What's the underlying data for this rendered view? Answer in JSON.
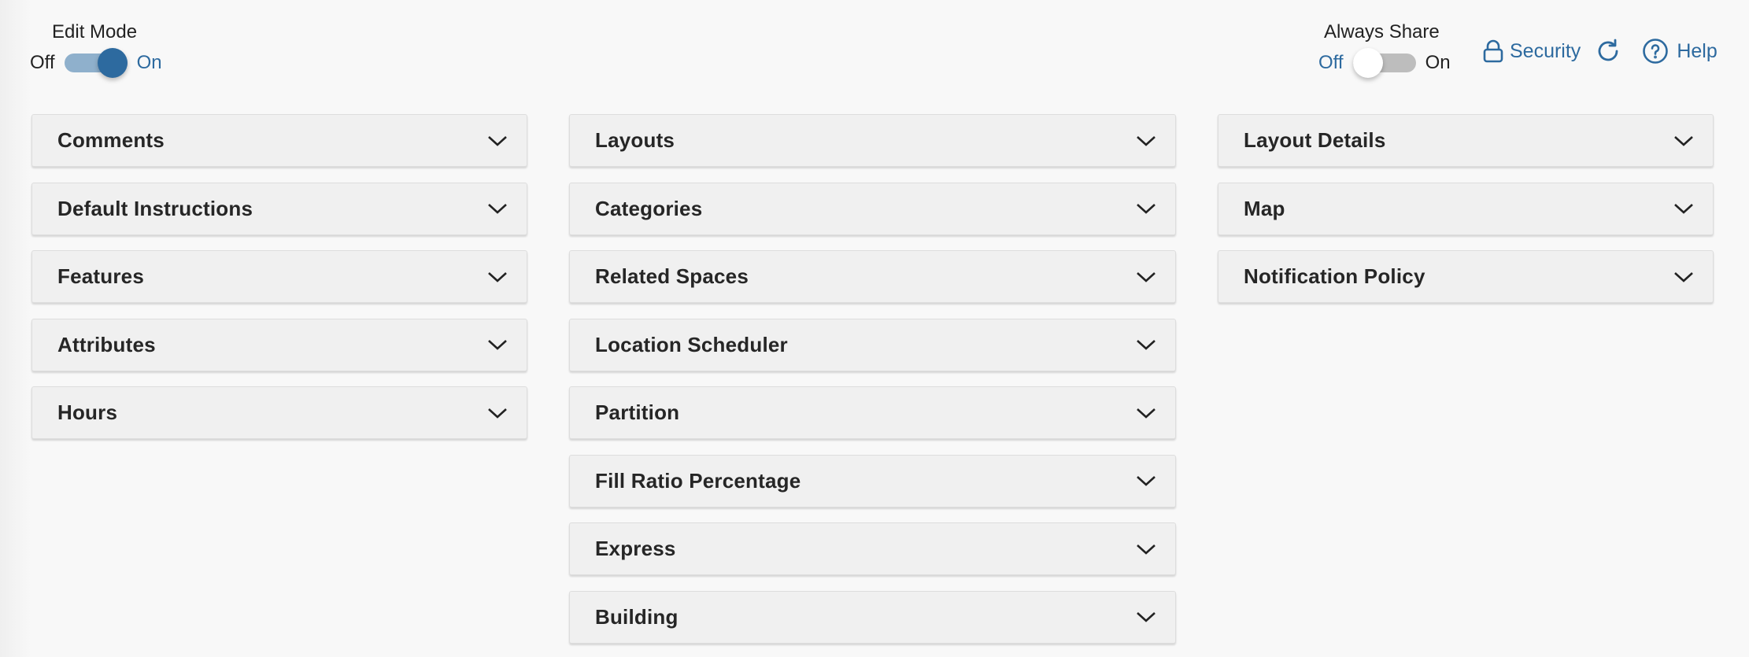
{
  "header": {
    "edit_mode": {
      "title": "Edit Mode",
      "off_label": "Off",
      "on_label": "On",
      "state": "on"
    },
    "always_share": {
      "title": "Always Share",
      "off_label": "Off",
      "on_label": "On",
      "state": "off"
    },
    "actions": {
      "security_label": "Security",
      "security_icon": "lock-icon",
      "refresh_icon": "refresh-icon",
      "help_label": "Help",
      "help_icon": "help-circle-icon"
    }
  },
  "colors": {
    "accent": "#2d6a9f",
    "toggle_track_on": "#8fb0cc",
    "toggle_track_off": "#bdbdbd",
    "panel_bg": "#f0f0f0",
    "page_bg": "#f8f8f8"
  },
  "columns": [
    {
      "panels": [
        {
          "title": "Comments"
        },
        {
          "title": "Default Instructions"
        },
        {
          "title": "Features"
        },
        {
          "title": "Attributes"
        },
        {
          "title": "Hours"
        }
      ]
    },
    {
      "panels": [
        {
          "title": "Layouts"
        },
        {
          "title": "Categories"
        },
        {
          "title": "Related Spaces"
        },
        {
          "title": "Location Scheduler"
        },
        {
          "title": "Partition"
        },
        {
          "title": "Fill Ratio Percentage"
        },
        {
          "title": "Express"
        },
        {
          "title": "Building"
        }
      ]
    },
    {
      "panels": [
        {
          "title": "Layout Details"
        },
        {
          "title": "Map"
        },
        {
          "title": "Notification Policy"
        }
      ]
    }
  ]
}
